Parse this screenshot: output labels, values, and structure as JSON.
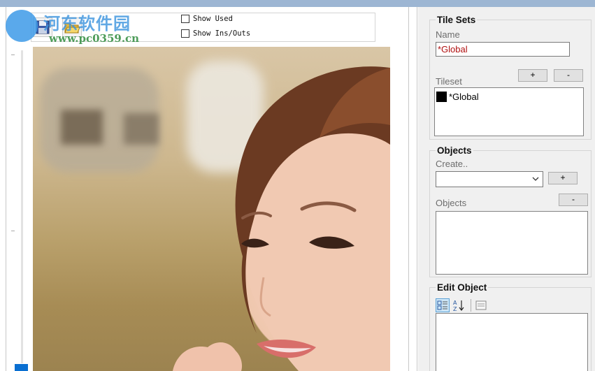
{
  "watermark": {
    "title": "河东软件园",
    "url": "www.pc0359.cn"
  },
  "toolbar": {
    "save_icon": "save-icon",
    "open_icon": "folder-open-icon",
    "show_used_label": "Show Used",
    "show_ins_outs_label": "Show Ins/Outs",
    "show_used_checked": false,
    "show_ins_outs_checked": false
  },
  "tile_sets": {
    "title": "Tile Sets",
    "name_label": "Name",
    "name_value": "*Global",
    "tileset_label": "Tileset",
    "add_label": "+",
    "remove_label": "-",
    "items": [
      {
        "label": "*Global",
        "swatch": "#000000"
      }
    ]
  },
  "objects": {
    "title": "Objects",
    "create_label": "Create..",
    "create_value": "",
    "add_label": "+",
    "remove_label": "-",
    "objects_label": "Objects"
  },
  "edit_object": {
    "title": "Edit Object",
    "categorized_icon": "categorized-icon",
    "alphabetical_icon": "sort-az-icon",
    "property_pages_icon": "property-pages-icon"
  },
  "colors": {
    "accent": "#0a6fd1",
    "name_text": "#b01010",
    "title_bar": "#9db6d3",
    "panel_bg": "#f0f0f0"
  }
}
